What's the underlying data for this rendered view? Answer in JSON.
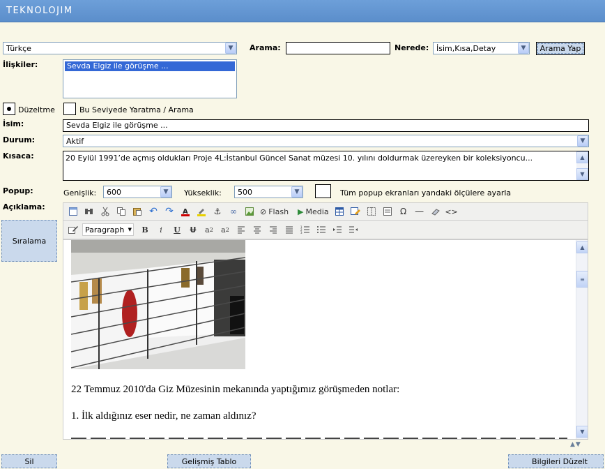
{
  "app": {
    "title": "TEKNOLOJIM"
  },
  "filters": {
    "language": "Türkçe",
    "search_label": "Arama:",
    "search_value": "",
    "where_label": "Nerede:",
    "where_value": "İsim,Kısa,Detay",
    "search_button": "Arama Yap"
  },
  "relations": {
    "label": "İlişkiler:",
    "items": [
      "Sevda Elgiz ile görüşme ..."
    ]
  },
  "mode": {
    "edit_label": "Düzeltme",
    "create_label": "Bu Seviyede Yaratma / Arama",
    "selected": "edit"
  },
  "form": {
    "name_label": "İsim:",
    "name_value": "Sevda Elgiz ile görüşme ...",
    "status_label": "Durum:",
    "status_value": "Aktif",
    "short_label": "Kısaca:",
    "short_value": "20 Eylül 1991’de açmış oldukları Proje 4L:İstanbul Güncel Sanat müzesi 10. yılını doldurmak üzereyken bir koleksiyoncu...",
    "popup_label": "Popup:",
    "width_label": "Genişlik:",
    "width_value": "600",
    "height_label": "Yükseklik:",
    "height_value": "500",
    "apply_all_label": "Tüm popup ekranları yandaki ölçülere ayarla",
    "description_label": "Açıklama:",
    "sort_button": "Sıralama"
  },
  "editor": {
    "toolbar1": [
      "Flash",
      "Media"
    ],
    "paragraph_format": "Paragraph",
    "content": [
      "22 Temmuz 2010'da Giz Müzesinin mekanında yaptığımız görüşmeden notlar:",
      "1. İlk aldığınız eser nedir, ne zaman aldınız?"
    ]
  },
  "footer": {
    "delete_button": "Sil",
    "advanced_table_button": "Gelişmiş Tablo",
    "update_button": "Bilgileri Düzelt"
  },
  "colors": {
    "header": "#5b8ecb",
    "background": "#f9f7e7",
    "button": "#cad9ec",
    "selection": "#3468d6"
  }
}
